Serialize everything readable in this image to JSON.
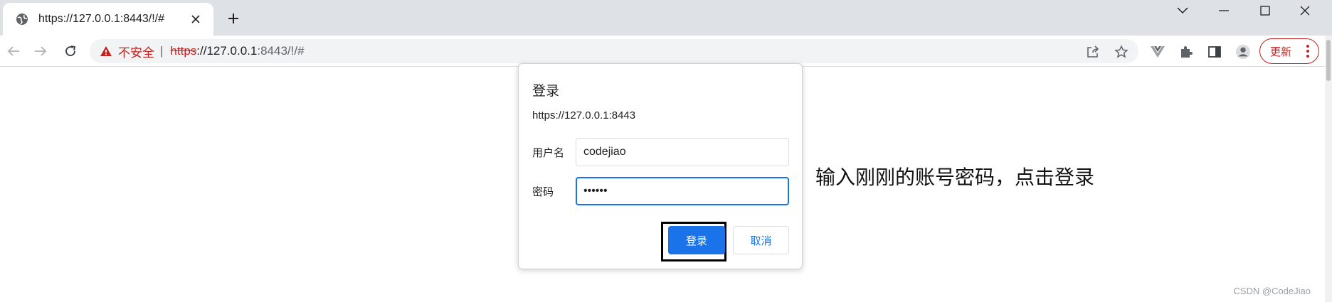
{
  "tab": {
    "title": "https://127.0.0.1:8443/!/#",
    "favicon": "globe-icon"
  },
  "window_controls": {
    "chevron": "chevron-down-icon",
    "minimize": "minimize-icon",
    "maximize": "maximize-icon",
    "close": "close-icon"
  },
  "omnibox": {
    "insecure_label": "不安全",
    "separator": "|",
    "scheme": "https",
    "host": "://127.0.0.1",
    "path": ":8443/!/#"
  },
  "toolbar": {
    "update_label": "更新"
  },
  "dialog": {
    "title": "登录",
    "url": "https://127.0.0.1:8443",
    "username_label": "用户名",
    "username_value": "codejiao",
    "password_label": "密码",
    "password_value": "••••••",
    "login_button": "登录",
    "cancel_button": "取消"
  },
  "annotation": "输入刚刚的账号密码，点击登录",
  "watermark": "CSDN @CodeJiao",
  "colors": {
    "accent": "#1a73e8",
    "danger": "#c5221f",
    "tabstrip": "#dee1e6"
  }
}
